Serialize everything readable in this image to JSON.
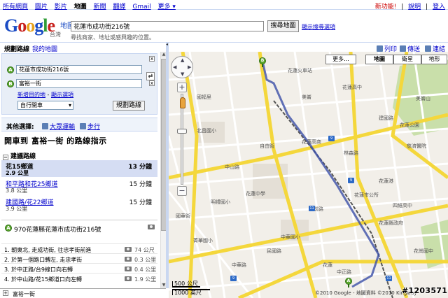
{
  "topbar": {
    "links": [
      "所有網頁",
      "圖片",
      "影片",
      "地圖",
      "新聞",
      "翻譯",
      "Gmail",
      "更多 ▾"
    ],
    "selected_index": 3,
    "new_feature": "新功能!",
    "help": "說明",
    "login": "登入"
  },
  "header": {
    "logo_text": "Google",
    "logo_sub": "地圖",
    "logo_region": "台灣",
    "search_value": "花蓮市成功街216號",
    "search_button": "搜尋地圖",
    "search_options": "顯示搜尋選項",
    "search_hint": "尋找商家、地址或感興趣的位置。"
  },
  "panel_tabs": {
    "directions": "規劃路線",
    "my_maps": "我的地圖"
  },
  "directions_form": {
    "start_marker": "A",
    "start_value": "花蓮市成功街216號",
    "end_marker": "B",
    "end_value": "富裕一街",
    "close_label": "x",
    "swap_label": "⇄",
    "add_destination": "新增目的地",
    "separator": " - ",
    "show_options": "顯示選項",
    "mode": "自行開車",
    "mode_arrow": "▾",
    "plan_button": "規劃路線"
  },
  "other_options": {
    "label": "其他選擇:",
    "transit": "大眾運輸",
    "walking": "步行"
  },
  "directions_title": "開車到 富裕一街 的路線指示",
  "suggested": {
    "toggle": "−",
    "heading": "建議路線",
    "main": {
      "name": "花15鄉道",
      "distance": "2.9 公里",
      "time": "13 分鐘"
    },
    "alternates": [
      {
        "name": "和平路和花25鄉道",
        "distance": "3.8 公里",
        "time": "15 分鐘"
      },
      {
        "name": "建國路/花22鄉道",
        "distance": "3.9 公里",
        "time": "15 分鐘"
      }
    ]
  },
  "start_address": {
    "marker": "A",
    "text": "970花蓮縣花蓮市成功街216號"
  },
  "steps": [
    {
      "text": "1. 朝東北, 走成功街, 往忠孝街前進",
      "dist": "74 公尺"
    },
    {
      "text": "2. 於第一個路口轉左, 走忠孝街",
      "dist": "0.3 公里"
    },
    {
      "text": "3. 於中正路/台9線口向右轉",
      "dist": "0.4 公里"
    },
    {
      "text": "4. 於中山路/花15鄉道口向左轉",
      "dist": "1.9 公里"
    }
  ],
  "dest_bar": {
    "toggle": "+",
    "text": "富裕一街"
  },
  "map_toolbar": {
    "print": "列印",
    "send": "傳送",
    "link": "連結"
  },
  "map_types": {
    "more": "更多...",
    "map": "地圖",
    "satellite": "衛星",
    "terrain": "地形"
  },
  "zoom": {
    "in": "+",
    "out": "−"
  },
  "scale": {
    "metric": "500 公尺",
    "imperial": "1000 英尺"
  },
  "copyright": "©2010 Google - 地圖資料 ©2010 Kingway",
  "watermark": "#1203571",
  "map_labels": [
    "花蓮火車站",
    "花蓮高商",
    "花蓮高中",
    "北昌國小",
    "花蓮中學",
    "花蓮市公所",
    "花蓮港",
    "慈濟醫院",
    "花蓮縣政府",
    "明禮國小",
    "美崙山",
    "中華路",
    "花蓮",
    "美崙",
    "國華街",
    "中正路",
    "中山路",
    "民國路",
    "建國路",
    "府前路",
    "林森路",
    "自由街",
    "中華國小",
    "國福里",
    "花蓮公園",
    "四維高中",
    "菁華國小",
    "花崗國中"
  ],
  "road_signs": [
    "9",
    "9",
    "11",
    "9",
    "11"
  ],
  "map_pins": [
    "B",
    "A"
  ],
  "colors": {
    "route": "#3b4fa8",
    "major_road": "#f4d73c",
    "minor_road": "#ffffff",
    "rail": "#555555",
    "park": "#c9dfaa",
    "water": "#a7c1ea"
  }
}
